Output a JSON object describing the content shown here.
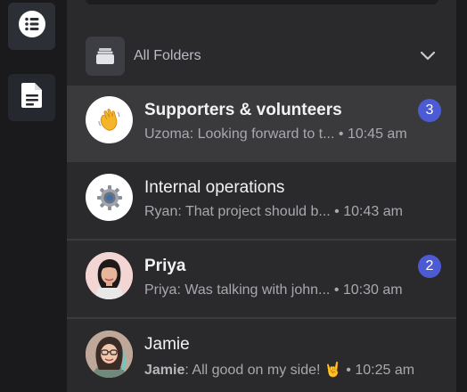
{
  "rail": {
    "items": [
      {
        "icon": "list-icon"
      },
      {
        "icon": "document-icon"
      }
    ]
  },
  "folder": {
    "label": "All Folders",
    "icon": "folder-stack-icon",
    "chevron": "chevron-down-icon"
  },
  "chats": [
    {
      "title": "Supporters & volunteers",
      "bold": true,
      "active": true,
      "sender": "Uzoma",
      "message": "Looking forward to t...",
      "time": "10:45 am",
      "unread": "3",
      "avatar": "waving-hand-emoji"
    },
    {
      "title": "Internal operations",
      "bold": false,
      "active": false,
      "sender": "Ryan",
      "message": "That project should b...",
      "time": "10:43 am",
      "unread": "",
      "avatar": "gear-emoji"
    },
    {
      "title": "Priya",
      "bold": true,
      "active": false,
      "sender": "Priya",
      "message": "Was talking with john...",
      "time": "10:30 am",
      "unread": "2",
      "avatar": "priya-photo"
    },
    {
      "title": "Jamie",
      "bold": false,
      "active": false,
      "sender": "Jamie",
      "message": "All good on my side! 🤘",
      "time": "10:25 am",
      "unread": "",
      "avatar": "jamie-photo"
    }
  ],
  "colors": {
    "badge": "#4c5bd4",
    "active_row": "#3a3a3d",
    "panel": "#2a2a2c"
  }
}
